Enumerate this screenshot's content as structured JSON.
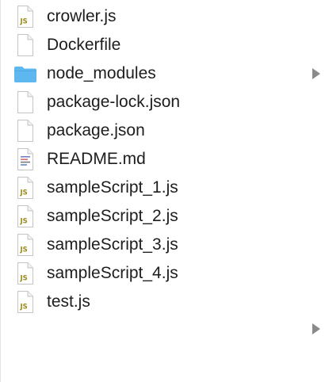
{
  "files": [
    {
      "name": "crowler.js",
      "icon": "js-file-icon",
      "kind": "js"
    },
    {
      "name": "Dockerfile",
      "icon": "document-icon",
      "kind": "blank"
    },
    {
      "name": "node_modules",
      "icon": "folder-icon",
      "kind": "folder"
    },
    {
      "name": "package-lock.json",
      "icon": "document-icon",
      "kind": "blank"
    },
    {
      "name": "package.json",
      "icon": "document-icon",
      "kind": "blank"
    },
    {
      "name": "README.md",
      "icon": "markdown-file-icon",
      "kind": "md"
    },
    {
      "name": "sampleScript_1.js",
      "icon": "js-file-icon",
      "kind": "js"
    },
    {
      "name": "sampleScript_2.js",
      "icon": "js-file-icon",
      "kind": "js"
    },
    {
      "name": "sampleScript_3.js",
      "icon": "js-file-icon",
      "kind": "js"
    },
    {
      "name": "sampleScript_4.js",
      "icon": "js-file-icon",
      "kind": "js"
    },
    {
      "name": "test.js",
      "icon": "js-file-icon",
      "kind": "js"
    }
  ],
  "icons": {
    "js_badge": "JS",
    "js_badge_color": "#9a8a1a",
    "folder_color": "#5eb7ef",
    "chevron_color": "#8a8a8a"
  }
}
